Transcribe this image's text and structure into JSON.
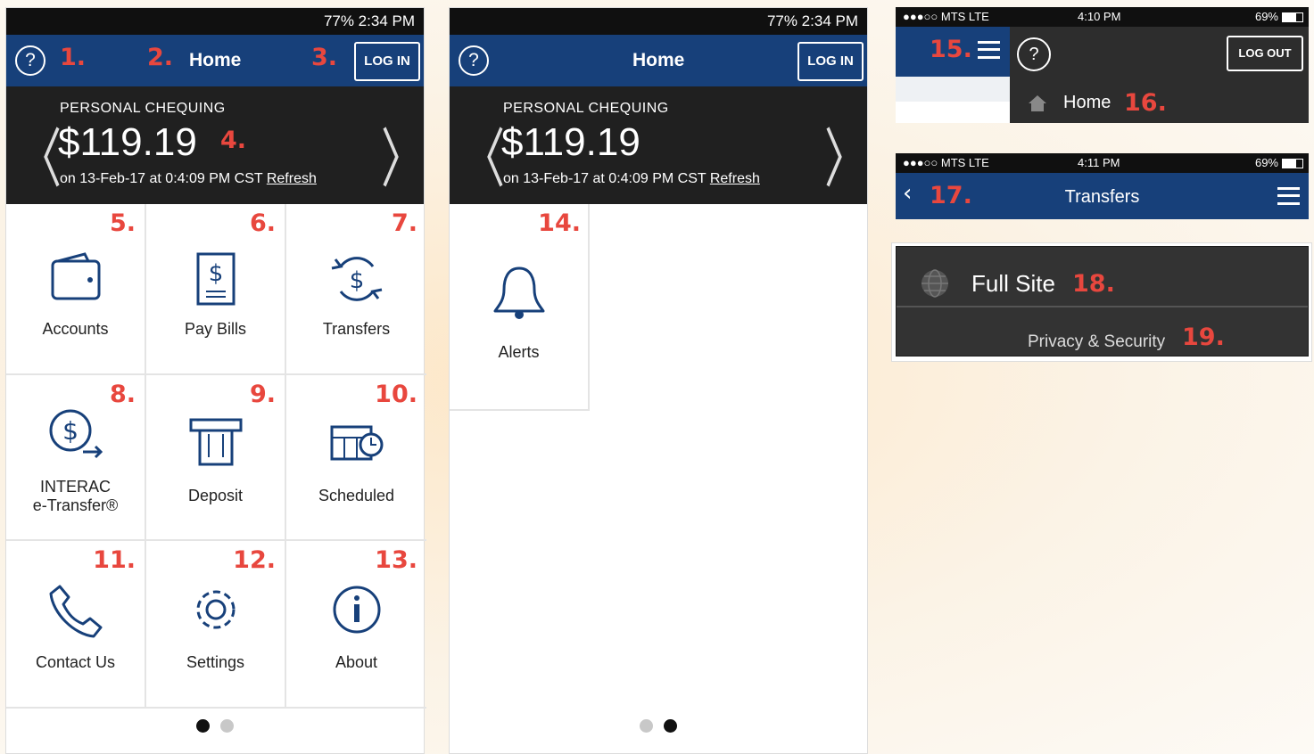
{
  "status": {
    "android": "77% 2:34 PM",
    "ios1_carrier": "●●●○○ MTS  LTE",
    "ios1_time": "4:10 PM",
    "ios1_battery": "69%",
    "ios2_carrier": "●●●○○ MTS  LTE",
    "ios2_time": "4:11 PM",
    "ios2_battery": "69%"
  },
  "header": {
    "title": "Home",
    "login": "LOG IN",
    "help": "?"
  },
  "account": {
    "name": "PERSONAL CHEQUING",
    "balance": "$119.19",
    "timestamp": "on 13-Feb-17 at 0:4:09 PM CST",
    "refresh": "Refresh"
  },
  "tiles": {
    "accounts": "Accounts",
    "paybills": "Pay Bills",
    "transfers": "Transfers",
    "interac1": "INTERAC",
    "interac2": "e-Transfer®",
    "deposit": "Deposit",
    "scheduled": "Scheduled",
    "contact": "Contact Us",
    "settings": "Settings",
    "about": "About",
    "alerts": "Alerts"
  },
  "numbers": {
    "n1": "1.",
    "n2": "2.",
    "n3": "3.",
    "n4": "4.",
    "n5": "5.",
    "n6": "6.",
    "n7": "7.",
    "n8": "8.",
    "n9": "9.",
    "n10": "10.",
    "n11": "11.",
    "n12": "12.",
    "n13": "13.",
    "n14": "14.",
    "n15": "15.",
    "n16": "16.",
    "n17": "17.",
    "n18": "18.",
    "n19": "19."
  },
  "ios_menu": {
    "logout": "LOG OUT",
    "home": "Home",
    "help": "?"
  },
  "ios_transfers": {
    "title": "Transfers"
  },
  "footer_menu": {
    "full_site": "Full Site",
    "privacy": "Privacy & Security"
  },
  "colors": {
    "brand_blue": "#17407a",
    "dark": "#202020",
    "annotation_red": "#e8473e"
  }
}
